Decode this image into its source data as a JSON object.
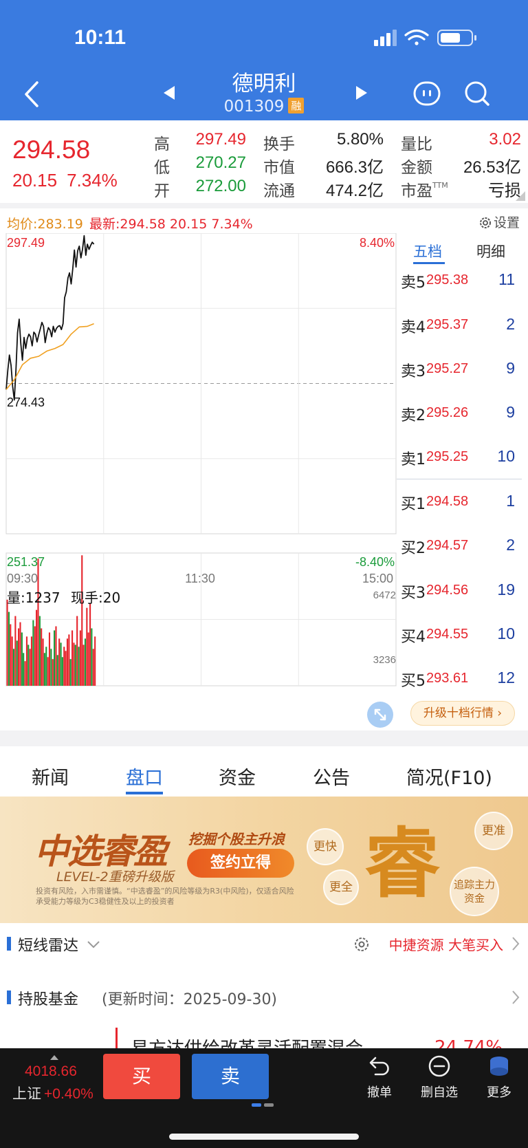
{
  "status": {
    "time": "10:11"
  },
  "header": {
    "name": "德明利",
    "code": "001309",
    "badge": "融"
  },
  "quote": {
    "price": "294.58",
    "change": "20.15",
    "change_pct": "7.34%",
    "high_label": "高",
    "high": "297.49",
    "low_label": "低",
    "low": "270.27",
    "open_label": "开",
    "open": "272.00",
    "turnover_label": "换手",
    "turnover": "5.80%",
    "mcap_label": "市值",
    "mcap": "666.3亿",
    "float_label": "流通",
    "float": "474.2亿",
    "vol_ratio_label": "量比",
    "vol_ratio": "3.02",
    "amount_label": "金额",
    "amount": "26.53亿",
    "pe_label": "市盈",
    "pe_suffix": "TTM",
    "pe": "亏损"
  },
  "chart_header": {
    "avg": "均价:283.19",
    "latest": "最新:294.58 20.15 7.34%",
    "settings": "设置"
  },
  "chart_data": {
    "type": "line",
    "y_top_label": "297.49",
    "y_mid_label": "274.43",
    "y_bottom_label": "251.37",
    "pct_top_label": "8.40%",
    "pct_bottom_label": "-8.40%",
    "ylim": [
      251.37,
      297.49
    ],
    "prev_close": 274.43,
    "x_ticks": [
      "09:30",
      "11:30",
      "15:00"
    ],
    "total_minutes": 240,
    "series": [
      {
        "name": "最新",
        "color": "#111111",
        "x": [
          0,
          1,
          2,
          3,
          4,
          5,
          6,
          7,
          8,
          9,
          10,
          11,
          12,
          13,
          14,
          15,
          16,
          17,
          18,
          19,
          20,
          21,
          22,
          23,
          24,
          25,
          26,
          27,
          28,
          29,
          30,
          31,
          32,
          33,
          34,
          35,
          36,
          37,
          38,
          39,
          40,
          41,
          42,
          43,
          44,
          45,
          46,
          47,
          48,
          49,
          50,
          51,
          52,
          53,
          54
        ],
        "values": [
          273.5,
          276.5,
          278.8,
          277.2,
          274.0,
          271.9,
          276.5,
          282.2,
          284.3,
          280.5,
          278.0,
          281.5,
          279.8,
          281.3,
          282.0,
          281.6,
          280.2,
          282.3,
          282.0,
          280.8,
          281.9,
          282.8,
          283.8,
          283.2,
          280.7,
          282.1,
          283.0,
          282.6,
          281.6,
          283.2,
          282.3,
          282.9,
          283.2,
          283.3,
          282.7,
          283.6,
          287.6,
          288.5,
          290.6,
          291.4,
          289.7,
          292.1,
          294.9,
          292.3,
          294.8,
          295.5,
          293.7,
          295.0,
          297.1,
          294.1,
          295.8,
          295.0,
          295.6,
          296.1,
          295.8
        ]
      },
      {
        "name": "均价",
        "color": "#f0a020",
        "x": [
          0,
          5,
          10,
          15,
          20,
          25,
          30,
          35,
          40,
          45,
          50,
          54
        ],
        "values": [
          273.5,
          275.0,
          277.3,
          278.3,
          278.6,
          279.4,
          279.8,
          280.4,
          282.0,
          283.1,
          283.2,
          283.6
        ]
      }
    ],
    "volume": {
      "label": "量:1237",
      "hand_label": "现手:20",
      "max_label": "6472",
      "mid_label": "3236",
      "ylim": [
        0,
        6472
      ],
      "values": [
        4200,
        3600,
        3000,
        2400,
        1800,
        3400,
        2200,
        2800,
        3100,
        2600,
        1600,
        1200,
        2400,
        2000,
        1800,
        2400,
        3200,
        2900,
        3700,
        6200,
        3400,
        2800,
        2300,
        1600,
        1900,
        1400,
        2600,
        1800,
        1300,
        2700,
        2900,
        1500,
        2300,
        2100,
        1400,
        1900,
        1700,
        2300,
        2500,
        1300,
        2700,
        2100,
        2000,
        3400,
        1900,
        2700,
        6360,
        2000,
        2300,
        3800,
        2600,
        4000,
        2800,
        1800,
        2400
      ],
      "colors_red": [
        1,
        0,
        1,
        1,
        0,
        1,
        0,
        1,
        1,
        0,
        0,
        1,
        1,
        0,
        1,
        1,
        0,
        1,
        1,
        1,
        0,
        1,
        1,
        0,
        0,
        1,
        1,
        0,
        1,
        0,
        1,
        0,
        1,
        0,
        0,
        1,
        1,
        1,
        1,
        0,
        1,
        1,
        0,
        1,
        0,
        1,
        1,
        1,
        0,
        1,
        1,
        1,
        0,
        1,
        1
      ]
    }
  },
  "orderbook": {
    "tab_active": "五档",
    "tab_inactive": "明细",
    "asks": [
      {
        "label": "卖5",
        "price": "295.38",
        "vol": "11"
      },
      {
        "label": "卖4",
        "price": "295.37",
        "vol": "2"
      },
      {
        "label": "卖3",
        "price": "295.27",
        "vol": "9"
      },
      {
        "label": "卖2",
        "price": "295.26",
        "vol": "9"
      },
      {
        "label": "卖1",
        "price": "295.25",
        "vol": "10"
      }
    ],
    "bids": [
      {
        "label": "买1",
        "price": "294.58",
        "vol": "1"
      },
      {
        "label": "买2",
        "price": "294.57",
        "vol": "2"
      },
      {
        "label": "买3",
        "price": "294.56",
        "vol": "19"
      },
      {
        "label": "买4",
        "price": "294.55",
        "vol": "10"
      },
      {
        "label": "买5",
        "price": "293.61",
        "vol": "12"
      }
    ],
    "upgrade": "升级十档行情 ›"
  },
  "tabs": [
    "新闻",
    "盘口",
    "资金",
    "公告",
    "简况(F10)"
  ],
  "banner": {
    "title": "中选睿盈",
    "subtitle": "挖掘个股主升浪",
    "level": "LEVEL-2重磅升级版",
    "button": "签约立得",
    "disclaimer": "投资有风险，入市需谨慎。“中选睿盈”的风险等级为R3(中风险)，仅适合风险承受能力等级为C3稳健性及以上的投资者",
    "big_char": "睿",
    "bubble1": "更快",
    "bubble2": "更准",
    "bubble3": "更全",
    "bubble4": "追踪主力资金"
  },
  "radar": {
    "title": "短线雷达",
    "right": "中捷资源 大笔买入"
  },
  "funds": {
    "title": "持股基金",
    "subtitle": "(更新时间：2025-09-30)",
    "peek_name": "易方达供给改革灵活配置混合",
    "peek_value": "24.74%"
  },
  "bottom": {
    "index_value": "4018.66",
    "index_name": "上证",
    "index_pct": "+0.40%",
    "buy": "买",
    "sell": "卖",
    "action1": "撤单",
    "action2": "删自选",
    "action3": "更多"
  },
  "colors": {
    "header_bg": "#3a7be0",
    "up": "#e6262e",
    "down": "#1a9b3a",
    "accent": "#2a6fd6"
  }
}
